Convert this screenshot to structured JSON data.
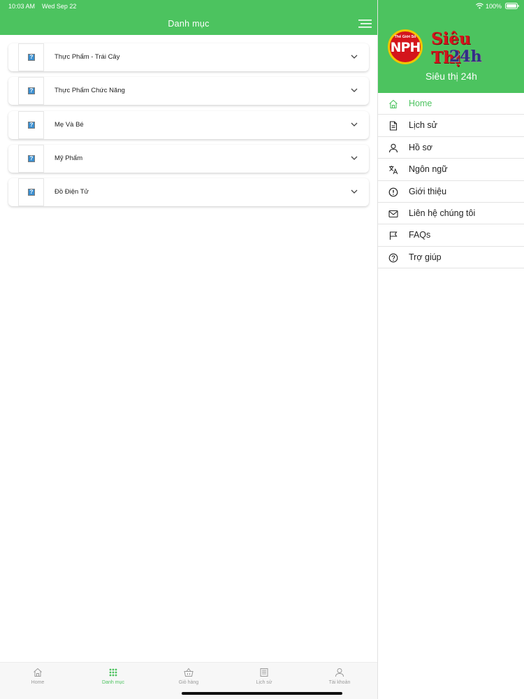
{
  "status_bar": {
    "time": "10:03 AM",
    "date": "Wed Sep 22",
    "battery": "100%"
  },
  "header": {
    "title": "Danh mục",
    "menu_icon": "hamburger-icon"
  },
  "categories": [
    {
      "label": "Thực Phẩm - Trái Cây",
      "thumb": "?"
    },
    {
      "label": "Thực Phẩm Chức Năng",
      "thumb": "?"
    },
    {
      "label": "Mẹ Và Bé",
      "thumb": "?"
    },
    {
      "label": "Mỹ Phẩm",
      "thumb": "?"
    },
    {
      "label": "Đồ Điện Tử",
      "thumb": "?"
    }
  ],
  "tabbar": {
    "active": "Danh mục",
    "tabs": [
      {
        "label": "Home",
        "icon": "home-icon"
      },
      {
        "label": "Danh mục",
        "icon": "grid-icon"
      },
      {
        "label": "Giỏ hàng",
        "icon": "basket-icon"
      },
      {
        "label": "Lịch sử",
        "icon": "history-icon"
      },
      {
        "label": "Tài khoản",
        "icon": "user-icon"
      }
    ]
  },
  "drawer": {
    "logo": {
      "ring_text": "Thế Giới Số",
      "monogram": "NPH",
      "word1": "Siêu Thị",
      "word2": "24h"
    },
    "brand_name": "Siêu thị 24h",
    "items": [
      {
        "label": "Home",
        "icon": "home-icon"
      },
      {
        "label": "Lịch sử",
        "icon": "document-icon"
      },
      {
        "label": "Hồ sơ",
        "icon": "user-icon"
      },
      {
        "label": "Ngôn ngữ",
        "icon": "translate-icon"
      },
      {
        "label": "Giới thiệu",
        "icon": "info-icon"
      },
      {
        "label": "Liên hệ chúng tôi",
        "icon": "mail-icon"
      },
      {
        "label": "FAQs",
        "icon": "flag-icon"
      },
      {
        "label": "Trợ giúp",
        "icon": "help-icon"
      }
    ]
  },
  "colors": {
    "primary": "#4cc35f",
    "text": "#222222",
    "muted": "#9a9a9a",
    "logo_red": "#d4151c",
    "logo_blue": "#2f2f86"
  }
}
